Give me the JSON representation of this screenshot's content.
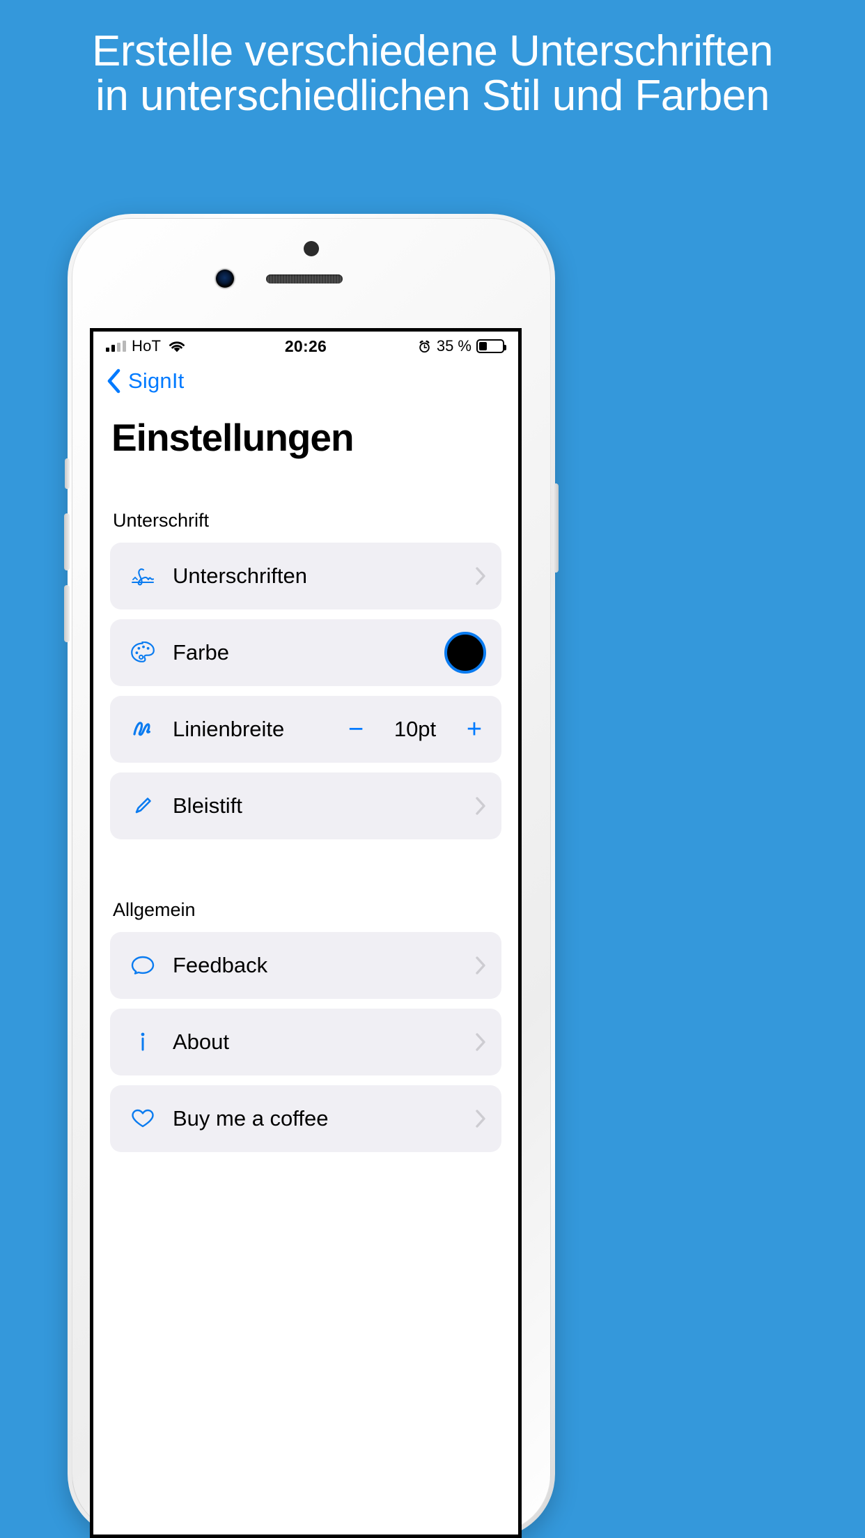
{
  "promo": {
    "line1": "Erstelle verschiedene Unterschriften",
    "line2": "in unterschiedlichen Stil und Farben",
    "background_color": "#3498db",
    "text_color": "#ffffff"
  },
  "status_bar": {
    "carrier": "HoT",
    "time": "20:26",
    "battery_percent": "35 %",
    "battery_level": 35,
    "signal_bars_filled": 2,
    "wifi_icon": "wifi-icon",
    "alarm_icon": "alarm-clock-icon",
    "battery_icon": "battery-icon"
  },
  "nav": {
    "back_label": "SignIt",
    "back_icon": "chevron-left-icon",
    "accent_color": "#007aff"
  },
  "page": {
    "title": "Einstellungen"
  },
  "sections": [
    {
      "header": "Unterschrift",
      "rows": [
        {
          "label": "Unterschriften",
          "icon": "signature-icon",
          "accessory": "chevron"
        },
        {
          "label": "Farbe",
          "icon": "palette-icon",
          "accessory": "color",
          "color_value": "#000000",
          "color_ring": "#0a7bf0"
        },
        {
          "label": "Linienbreite",
          "icon": "scribble-line-icon",
          "accessory": "stepper",
          "minus": "−",
          "plus": "+",
          "value": "10pt"
        },
        {
          "label": "Bleistift",
          "icon": "pencil-icon",
          "accessory": "chevron"
        }
      ]
    },
    {
      "header": "Allgemein",
      "rows": [
        {
          "label": "Feedback",
          "icon": "speech-bubble-icon",
          "accessory": "chevron"
        },
        {
          "label": "About",
          "icon": "info-icon",
          "accessory": "chevron"
        },
        {
          "label": "Buy me a coffee",
          "icon": "heart-icon",
          "accessory": "chevron"
        }
      ]
    }
  ]
}
